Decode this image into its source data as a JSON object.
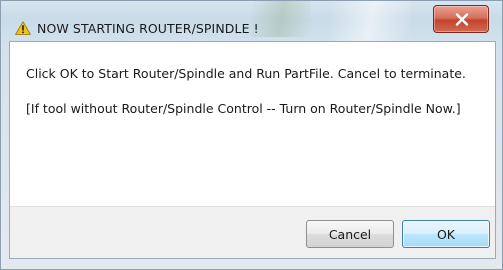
{
  "dialog": {
    "title": "NOW STARTING ROUTER/SPINDLE !",
    "title_icon": "warning-icon",
    "close_icon": "close-icon",
    "message_line1": "Click OK to Start Router/Spindle and Run PartFile. Cancel to terminate.",
    "message_line2": "[If tool without Router/Spindle Control -- Turn on Router/Spindle Now.]",
    "buttons": {
      "cancel_label": "Cancel",
      "ok_label": "OK"
    }
  },
  "colors": {
    "close_button": "#c9533d",
    "ok_button_border": "#3c7fb1",
    "warning": "#f2c21b"
  }
}
